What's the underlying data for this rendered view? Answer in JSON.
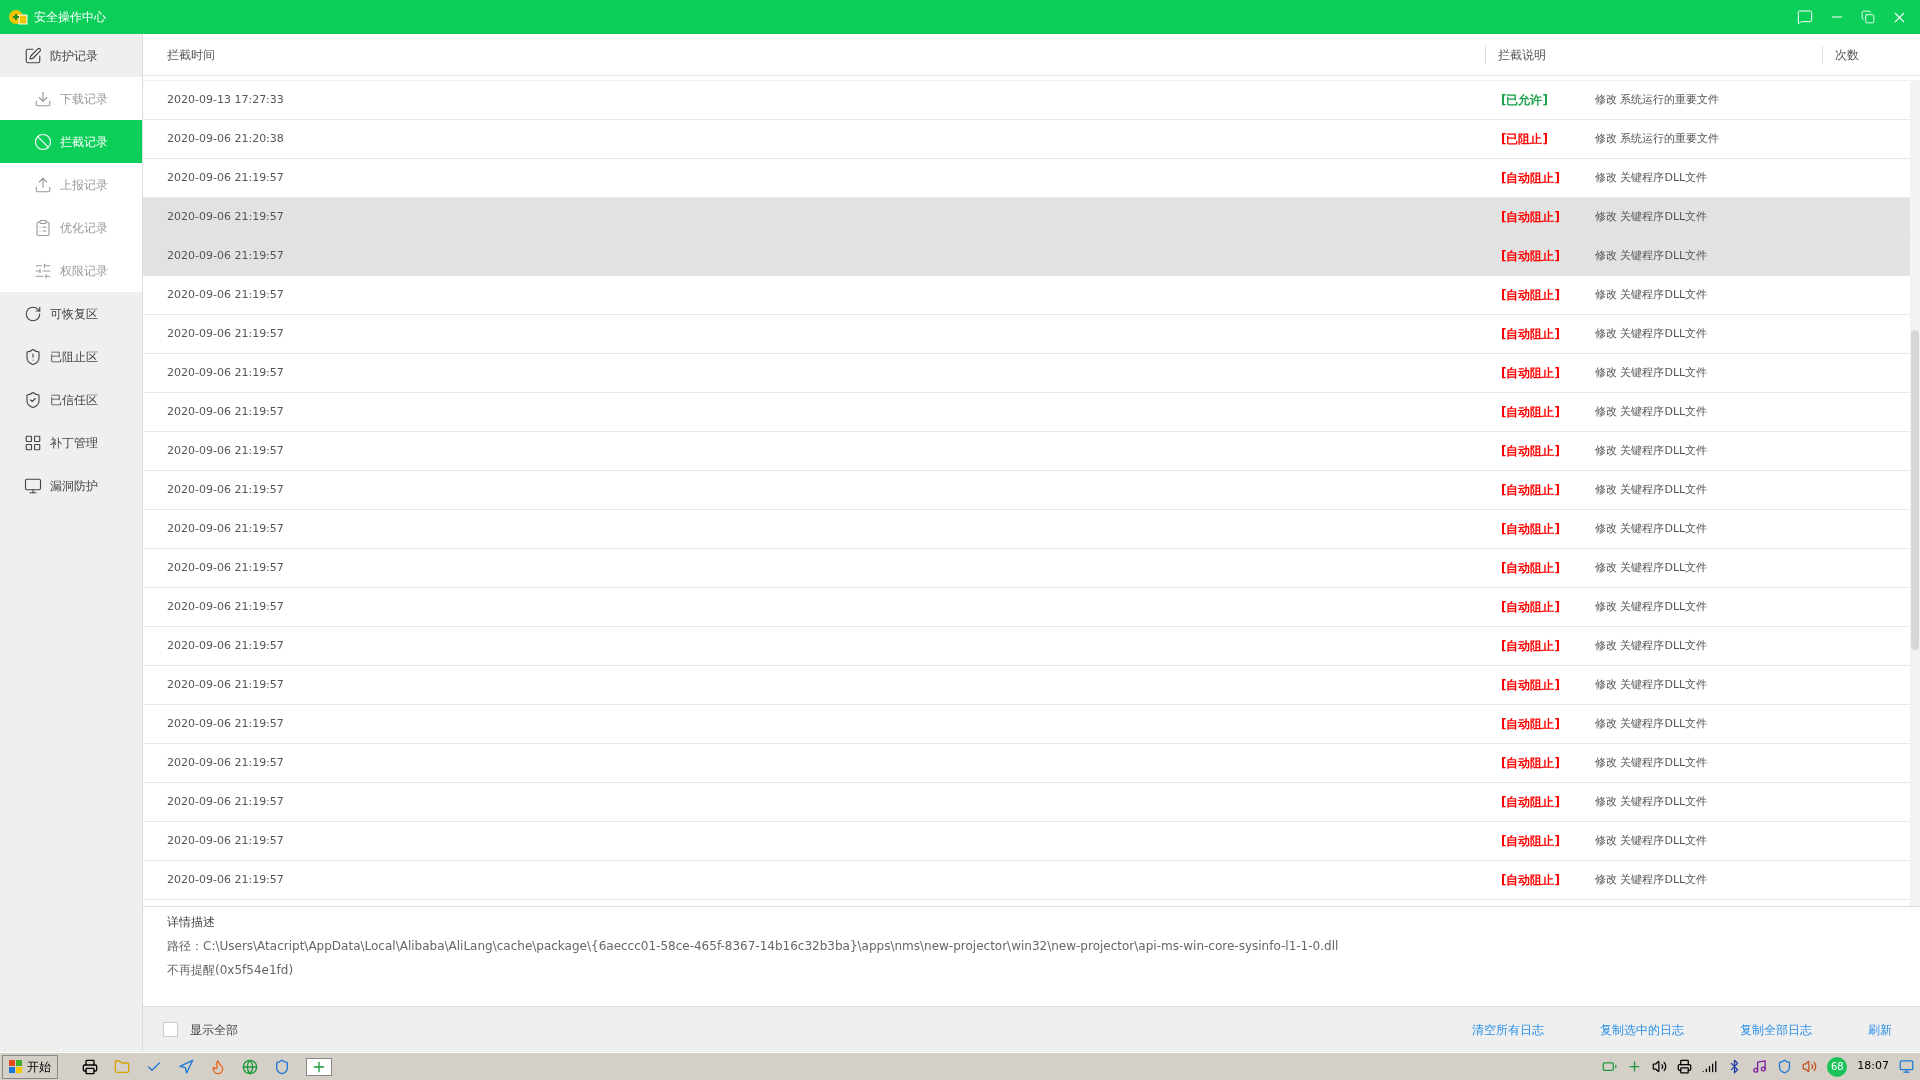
{
  "window": {
    "title": "安全操作中心"
  },
  "sidebar": {
    "items": [
      {
        "label": "防护记录",
        "selected": false,
        "children": [
          {
            "label": "下载记录",
            "selected": false
          },
          {
            "label": "拦截记录",
            "selected": true
          },
          {
            "label": "上报记录",
            "selected": false
          },
          {
            "label": "优化记录",
            "selected": false
          },
          {
            "label": "权限记录",
            "selected": false
          }
        ]
      },
      {
        "label": "可恢复区",
        "selected": false
      },
      {
        "label": "已阻止区",
        "selected": false
      },
      {
        "label": "已信任区",
        "selected": false
      },
      {
        "label": "补丁管理",
        "selected": false
      },
      {
        "label": "漏洞防护",
        "selected": false
      }
    ]
  },
  "table": {
    "columns": [
      "拦截时间",
      "拦截说明",
      "次数"
    ],
    "rows": [
      {
        "time": "2020-09-13 17:27:33",
        "status": "[已允许]",
        "color": "#1aa34a",
        "description": "修改 系统运行的重要文件",
        "selected": false
      },
      {
        "time": "2020-09-06 21:20:38",
        "status": "[已阻止]",
        "color": "#ff0000",
        "description": "修改 系统运行的重要文件",
        "selected": false
      },
      {
        "time": "2020-09-06 21:19:57",
        "status": "[自动阻止]",
        "color": "#ff0000",
        "description": "修改 关键程序DLL文件",
        "selected": false
      },
      {
        "time": "2020-09-06 21:19:57",
        "status": "[自动阻止]",
        "color": "#ff0000",
        "description": "修改 关键程序DLL文件",
        "selected": true
      },
      {
        "time": "2020-09-06 21:19:57",
        "status": "[自动阻止]",
        "color": "#ff0000",
        "description": "修改 关键程序DLL文件",
        "selected": true
      },
      {
        "time": "2020-09-06 21:19:57",
        "status": "[自动阻止]",
        "color": "#ff0000",
        "description": "修改 关键程序DLL文件",
        "selected": false
      },
      {
        "time": "2020-09-06 21:19:57",
        "status": "[自动阻止]",
        "color": "#ff0000",
        "description": "修改 关键程序DLL文件",
        "selected": false
      },
      {
        "time": "2020-09-06 21:19:57",
        "status": "[自动阻止]",
        "color": "#ff0000",
        "description": "修改 关键程序DLL文件",
        "selected": false
      },
      {
        "time": "2020-09-06 21:19:57",
        "status": "[自动阻止]",
        "color": "#ff0000",
        "description": "修改 关键程序DLL文件",
        "selected": false
      },
      {
        "time": "2020-09-06 21:19:57",
        "status": "[自动阻止]",
        "color": "#ff0000",
        "description": "修改 关键程序DLL文件",
        "selected": false
      },
      {
        "time": "2020-09-06 21:19:57",
        "status": "[自动阻止]",
        "color": "#ff0000",
        "description": "修改 关键程序DLL文件",
        "selected": false
      },
      {
        "time": "2020-09-06 21:19:57",
        "status": "[自动阻止]",
        "color": "#ff0000",
        "description": "修改 关键程序DLL文件",
        "selected": false
      },
      {
        "time": "2020-09-06 21:19:57",
        "status": "[自动阻止]",
        "color": "#ff0000",
        "description": "修改 关键程序DLL文件",
        "selected": false
      },
      {
        "time": "2020-09-06 21:19:57",
        "status": "[自动阻止]",
        "color": "#ff0000",
        "description": "修改 关键程序DLL文件",
        "selected": false
      },
      {
        "time": "2020-09-06 21:19:57",
        "status": "[自动阻止]",
        "color": "#ff0000",
        "description": "修改 关键程序DLL文件",
        "selected": false
      },
      {
        "time": "2020-09-06 21:19:57",
        "status": "[自动阻止]",
        "color": "#ff0000",
        "description": "修改 关键程序DLL文件",
        "selected": false
      },
      {
        "time": "2020-09-06 21:19:57",
        "status": "[自动阻止]",
        "color": "#ff0000",
        "description": "修改 关键程序DLL文件",
        "selected": false
      },
      {
        "time": "2020-09-06 21:19:57",
        "status": "[自动阻止]",
        "color": "#ff0000",
        "description": "修改 关键程序DLL文件",
        "selected": false
      },
      {
        "time": "2020-09-06 21:19:57",
        "status": "[自动阻止]",
        "color": "#ff0000",
        "description": "修改 关键程序DLL文件",
        "selected": false
      },
      {
        "time": "2020-09-06 21:19:57",
        "status": "[自动阻止]",
        "color": "#ff0000",
        "description": "修改 关键程序DLL文件",
        "selected": false
      },
      {
        "time": "2020-09-06 21:19:57",
        "status": "[自动阻止]",
        "color": "#ff0000",
        "description": "修改 关键程序DLL文件",
        "selected": false
      }
    ]
  },
  "details": {
    "title": "详情描述",
    "lines": [
      "路径：C:\\Users\\Atacript\\AppData\\Local\\Alibaba\\AliLang\\cache\\package\\{6aeccc01-58ce-465f-8367-14b16c32b3ba}\\apps\\nms\\new-projector\\win32\\new-projector\\api-ms-win-core-sysinfo-l1-1-0.dll",
      "不再提醒(0x5f54e1fd)"
    ]
  },
  "footer": {
    "show_all": {
      "label": "显示全部",
      "checked": false
    },
    "links": [
      "清空所有日志",
      "复制选中的日志",
      "复制全部日志",
      "刷新"
    ]
  },
  "taskbar": {
    "start": "开始",
    "clock": "18:07",
    "badge": "68"
  }
}
